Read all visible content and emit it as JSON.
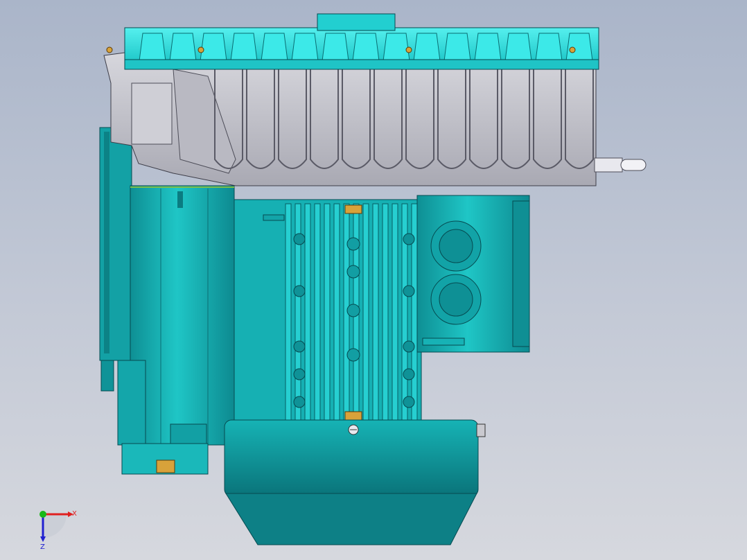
{
  "viewport": {
    "background_top": "#aab5c9",
    "background_bottom": "#d6d8de"
  },
  "model": {
    "colors": {
      "teal": "#12a9ab",
      "teal_dark": "#0b7f86",
      "teal_light": "#2ee3e0",
      "cyan_fins": "#34e4e4",
      "grey_shell": "#c9c9cf",
      "grey_dark": "#8b8b95",
      "brass": "#d8a23a",
      "steel": "#e8e8ee"
    }
  },
  "triad": {
    "x_label": "X",
    "z_label": "Z",
    "x_color": "#e02020",
    "y_color": "#18b818",
    "z_color": "#2020d0"
  }
}
